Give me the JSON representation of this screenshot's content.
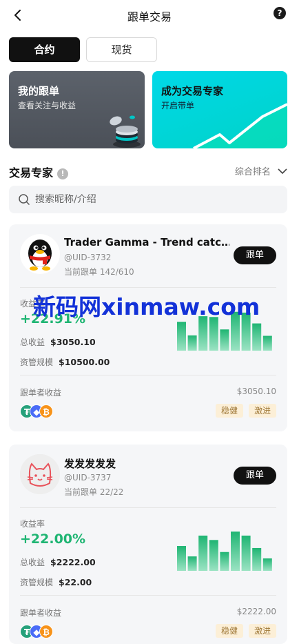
{
  "header": {
    "title": "跟单交易",
    "help": "?"
  },
  "tabs": [
    {
      "label": "合约",
      "active": true
    },
    {
      "label": "现货",
      "active": false
    }
  ],
  "promo": [
    {
      "title": "我的跟单",
      "subtitle": "查看关注与收益"
    },
    {
      "title": "成为交易专家",
      "subtitle": "开启带单"
    }
  ],
  "section": {
    "title": "交易专家",
    "info": "!",
    "sort": "综合排名"
  },
  "search": {
    "placeholder": "搜索昵称/介绍"
  },
  "watermark": "新码网xinmaw.com",
  "traders": [
    {
      "name": "Trader Gamma - Trend catc…",
      "uid": "@UID-3732",
      "current": "当前跟单 142/610",
      "follow": "跟单",
      "roi_label": "收益率",
      "roi": "+22.91%",
      "profit_label": "总收益",
      "profit": "$3050.10",
      "aum_label": "资管规模",
      "aum": "$10500.00",
      "follower_label": "跟单者收益",
      "follower_value": "$3050.10",
      "tags": [
        "稳健",
        "激进"
      ],
      "bars": [
        0.72,
        0.38,
        0.86,
        0.84,
        0.53,
        0.97,
        0.95,
        0.68,
        0.37
      ]
    },
    {
      "name": "发发发发发",
      "uid": "@UID-3737",
      "current": "当前跟单 22/22",
      "follow": "跟单",
      "roi_label": "收益率",
      "roi": "+22.00%",
      "profit_label": "总收益",
      "profit": "$2222.00",
      "aum_label": "资管规模",
      "aum": "$22.00",
      "follower_label": "跟单者收益",
      "follower_value": "$2222.00",
      "tags": [
        "稳健",
        "激进"
      ],
      "bars": [
        0.62,
        0.36,
        0.88,
        0.77,
        0.47,
        0.98,
        0.88,
        0.57,
        0.31
      ]
    }
  ],
  "colors": {
    "green": "#1fb573",
    "accent": "#00d8e8",
    "dark": "#111111"
  }
}
